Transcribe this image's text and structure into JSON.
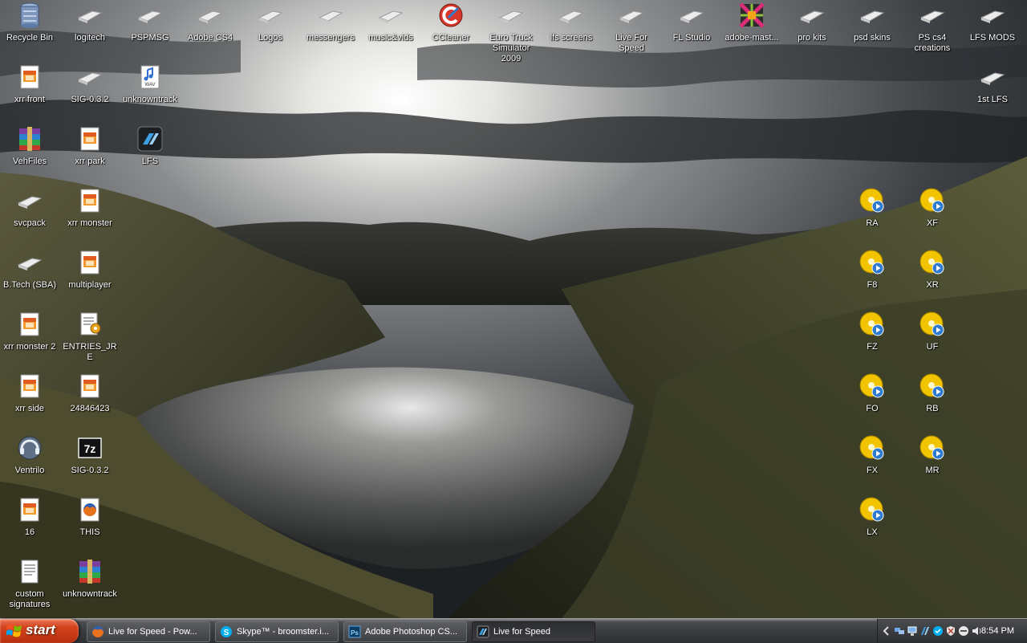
{
  "desktop": {
    "col1": {
      "recycle_bin": "Recycle Bin",
      "xrr_front": "xrr front",
      "vehfiles": "VehFiles",
      "svcpack": "svcpack",
      "btech": "B.Tech (SBA)",
      "xrr_monster2": "xrr monster 2",
      "xrr_side": "xrr side",
      "ventrilo": "Ventrilo",
      "n16": "16",
      "custom_signatures": "custom signatures"
    },
    "col2": {
      "logitech": "logitech",
      "sig032": "SIG-0.3.2",
      "xrr_park": "xrr park",
      "xrr_monster": "xrr monster",
      "multiplayer": "multiplayer",
      "entries_jre": "ENTRIES_JRE",
      "n24846423": "24846423",
      "sig032_7z": "SIG-0.3.2",
      "this": "THIS",
      "unknowntrack_rar": "unknowntrack"
    },
    "col3": {
      "pspmsg": "PSPMSG",
      "unknowntrack_wav": "unknowntrack",
      "lfs": "LFS"
    },
    "top_row": {
      "adobe_cs4": "Adobe CS4",
      "logos": "Logos",
      "messengers": "messengers",
      "music_vids": "music&vids",
      "ccleaner": "CCleaner",
      "euro_truck": "Euro Truck Simulator 2009",
      "lfs_screens": "lfs screens",
      "live_for_speed": "Live For Speed",
      "fl_studio": "FL Studio",
      "adobe_master": "adobe-mast...",
      "pro_kits": "pro kits",
      "psd_skins": "psd skins",
      "ps_cs4_creations": "PS cs4 creations",
      "lfs_mods": "LFS MODS"
    },
    "right": {
      "first_lfs": "1st LFS",
      "ra": "RA",
      "xf": "XF",
      "f8": "F8",
      "xr": "XR",
      "fz": "FZ",
      "uf": "UF",
      "fo": "FO",
      "rb": "RB",
      "fx": "FX",
      "mr": "MR",
      "lx": "LX"
    }
  },
  "taskbar": {
    "start_label": "start",
    "tasks": [
      {
        "label": "Live for Speed - Pow...",
        "icon": "firefox-icon"
      },
      {
        "label": "Skype™ - broomster.i...",
        "icon": "skype-icon"
      },
      {
        "label": "Adobe Photoshop CS...",
        "icon": "photoshop-icon"
      },
      {
        "label": "Live for Speed",
        "icon": "lfs-icon"
      }
    ],
    "clock": "8:54 PM"
  },
  "colors": {
    "start_button": "#d2421c",
    "taskbar": "#3a3c3f",
    "folder": "#e8e8e8",
    "disc": "#f2c400"
  }
}
